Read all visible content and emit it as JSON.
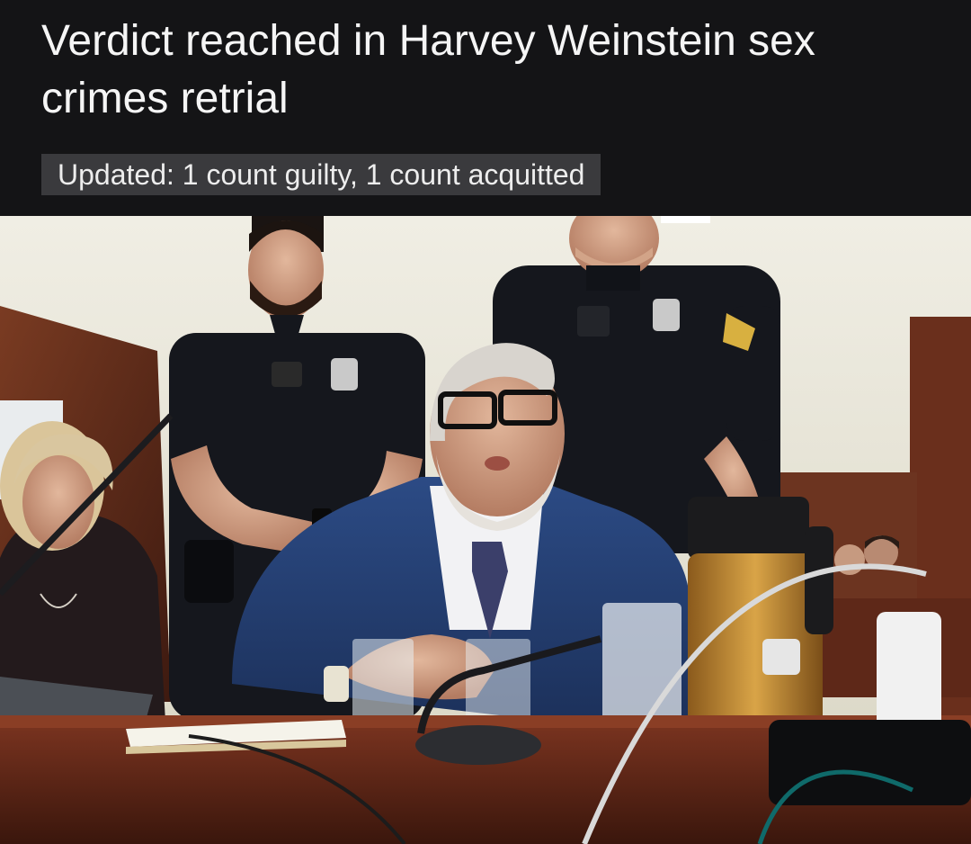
{
  "article": {
    "headline": "Verdict reached in Harvey Weinstein sex crimes retrial",
    "update_badge": "Updated: 1 count guilty, 1 count acquitted"
  },
  "photo": {
    "subject": "courtroom-photo"
  },
  "colors": {
    "background": "#141416",
    "badge_background": "#3a3a3d",
    "headline_text": "#f5f5f5",
    "officer_uniform": "#15171d",
    "suit_navy": "#233a6a",
    "wall": "#e6e3d6",
    "wood": "#5a2a19"
  }
}
